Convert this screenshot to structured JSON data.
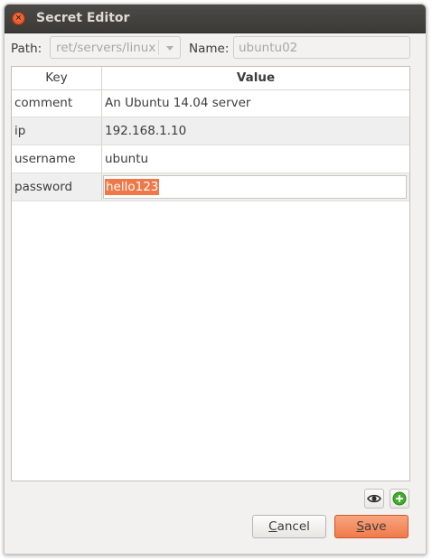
{
  "window": {
    "title": "Secret Editor",
    "close_symbol": "×"
  },
  "form": {
    "path_label": "Path:",
    "path_value": "ret/servers/linux",
    "name_label": "Name:",
    "name_value": "ubuntu02"
  },
  "table": {
    "headers": {
      "key": "Key",
      "value": "Value"
    },
    "rows": [
      {
        "key": "comment",
        "value": "An Ubuntu 14.04 server"
      },
      {
        "key": "ip",
        "value": "192.168.1.10"
      },
      {
        "key": "username",
        "value": "ubuntu"
      },
      {
        "key": "password",
        "value": "hello123"
      }
    ]
  },
  "buttons": {
    "cancel_first": "C",
    "cancel_rest": "ancel",
    "save_first": "S",
    "save_rest": "ave"
  },
  "icons": {
    "show_values": "eye-icon",
    "add_row": "add-icon"
  },
  "colors": {
    "accent": "#f07746",
    "add_green": "#3fae2a"
  }
}
